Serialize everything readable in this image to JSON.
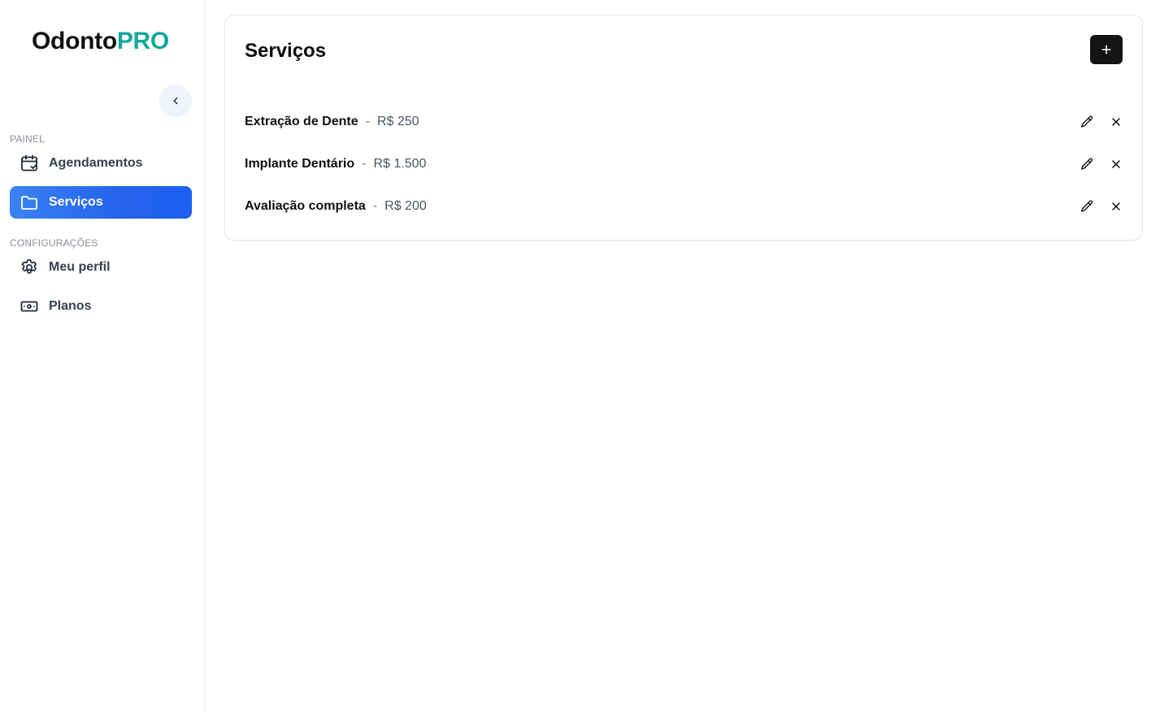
{
  "app": {
    "logo_primary": "Odonto",
    "logo_accent": "PRO",
    "accent_color": "#14a89a",
    "active_color": "#2563eb"
  },
  "sidebar": {
    "sections": [
      {
        "label": "PAINEL",
        "items": [
          {
            "label": "Agendamentos",
            "icon": "calendar-check-icon",
            "active": false
          },
          {
            "label": "Serviços",
            "icon": "folder-icon",
            "active": true
          }
        ]
      },
      {
        "label": "CONFIGURAÇÕES",
        "items": [
          {
            "label": "Meu perfil",
            "icon": "gear-icon",
            "active": false
          },
          {
            "label": "Planos",
            "icon": "banknote-icon",
            "active": false
          }
        ]
      }
    ]
  },
  "main": {
    "title": "Serviços",
    "services": [
      {
        "name": "Extração de Dente",
        "separator": "-",
        "price": "R$ 250"
      },
      {
        "name": "Implante Dentário",
        "separator": "-",
        "price": "R$ 1.500"
      },
      {
        "name": "Avaliação completa",
        "separator": "-",
        "price": "R$ 200"
      }
    ]
  }
}
